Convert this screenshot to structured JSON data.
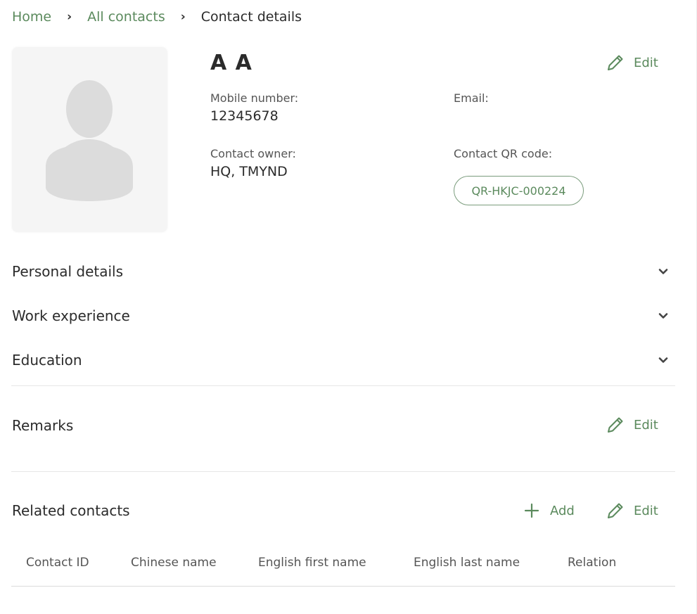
{
  "breadcrumb": {
    "items": [
      "Home",
      "All contacts"
    ],
    "separator": "›",
    "current": "Contact details"
  },
  "contact": {
    "name": "A A",
    "mobile_label": "Mobile number:",
    "mobile_value": "12345678",
    "email_label": "Email:",
    "email_value": "",
    "owner_label": "Contact owner:",
    "owner_value": "HQ, TMYND",
    "qr_label": "Contact QR code:",
    "qr_value": "QR-HKJC-000224",
    "edit_label": "Edit",
    "avatar_icon": "user-placeholder-icon"
  },
  "sections": {
    "personal": "Personal details",
    "work": "Work experience",
    "education": "Education"
  },
  "remarks": {
    "title": "Remarks",
    "edit_label": "Edit"
  },
  "related": {
    "title": "Related contacts",
    "add_label": "Add",
    "edit_label": "Edit",
    "columns": [
      "Contact ID",
      "Chinese name",
      "English first name",
      "English last name",
      "Relation"
    ]
  },
  "colors": {
    "accent": "#5b8a5d",
    "text": "#2b2b2b",
    "muted": "#555555",
    "avatar_bg": "#f5f5f5",
    "avatar_icon": "#dcdcdc"
  }
}
